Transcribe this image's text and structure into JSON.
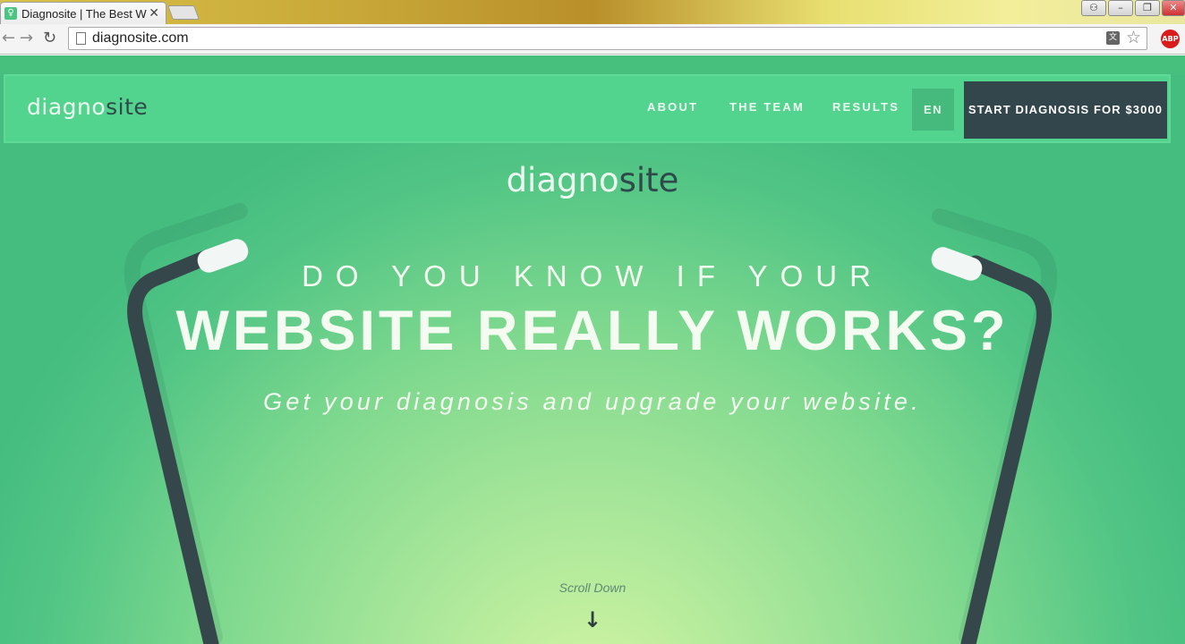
{
  "browser": {
    "tab_title": "Diagnosite | The Best W",
    "tab_favicon": "stethoscope-favicon",
    "url": "diagnosite.com",
    "abp_label": "ABP"
  },
  "nav": {
    "logo_light": "diag",
    "logo_mid": "no",
    "logo_dark": "site",
    "links": [
      "ABOUT",
      "THE TEAM",
      "RESULTS"
    ],
    "lang": "EN",
    "cta": "START DIAGNOSIS FOR $3000"
  },
  "hero": {
    "logo_light": "diag",
    "logo_mid": "no",
    "logo_dark": "site",
    "line1": "DO YOU KNOW IF YOUR",
    "line2": "WEBSITE REALLY WORKS?",
    "subtitle": "Get your diagnosis and upgrade your website.",
    "scroll_text": "Scroll Down",
    "scroll_arrow": "↓"
  },
  "colors": {
    "primary_green": "#53d48e",
    "dark_slate": "#33464b",
    "accent_light": "#d3f5a2"
  }
}
